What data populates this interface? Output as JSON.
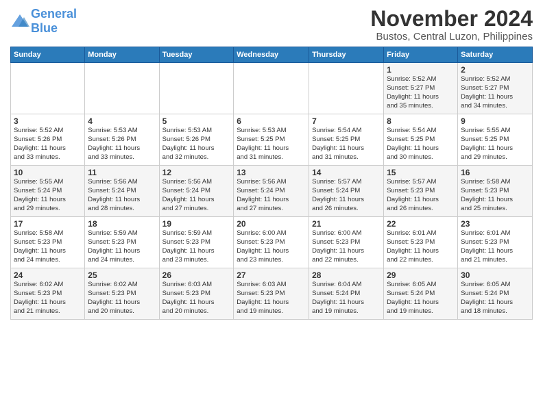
{
  "logo": {
    "text_general": "General",
    "text_blue": "Blue"
  },
  "header": {
    "month_year": "November 2024",
    "location": "Bustos, Central Luzon, Philippines"
  },
  "weekdays": [
    "Sunday",
    "Monday",
    "Tuesday",
    "Wednesday",
    "Thursday",
    "Friday",
    "Saturday"
  ],
  "weeks": [
    [
      {
        "day": "",
        "info": ""
      },
      {
        "day": "",
        "info": ""
      },
      {
        "day": "",
        "info": ""
      },
      {
        "day": "",
        "info": ""
      },
      {
        "day": "",
        "info": ""
      },
      {
        "day": "1",
        "info": "Sunrise: 5:52 AM\nSunset: 5:27 PM\nDaylight: 11 hours\nand 35 minutes."
      },
      {
        "day": "2",
        "info": "Sunrise: 5:52 AM\nSunset: 5:27 PM\nDaylight: 11 hours\nand 34 minutes."
      }
    ],
    [
      {
        "day": "3",
        "info": "Sunrise: 5:52 AM\nSunset: 5:26 PM\nDaylight: 11 hours\nand 33 minutes."
      },
      {
        "day": "4",
        "info": "Sunrise: 5:53 AM\nSunset: 5:26 PM\nDaylight: 11 hours\nand 33 minutes."
      },
      {
        "day": "5",
        "info": "Sunrise: 5:53 AM\nSunset: 5:26 PM\nDaylight: 11 hours\nand 32 minutes."
      },
      {
        "day": "6",
        "info": "Sunrise: 5:53 AM\nSunset: 5:25 PM\nDaylight: 11 hours\nand 31 minutes."
      },
      {
        "day": "7",
        "info": "Sunrise: 5:54 AM\nSunset: 5:25 PM\nDaylight: 11 hours\nand 31 minutes."
      },
      {
        "day": "8",
        "info": "Sunrise: 5:54 AM\nSunset: 5:25 PM\nDaylight: 11 hours\nand 30 minutes."
      },
      {
        "day": "9",
        "info": "Sunrise: 5:55 AM\nSunset: 5:25 PM\nDaylight: 11 hours\nand 29 minutes."
      }
    ],
    [
      {
        "day": "10",
        "info": "Sunrise: 5:55 AM\nSunset: 5:24 PM\nDaylight: 11 hours\nand 29 minutes."
      },
      {
        "day": "11",
        "info": "Sunrise: 5:56 AM\nSunset: 5:24 PM\nDaylight: 11 hours\nand 28 minutes."
      },
      {
        "day": "12",
        "info": "Sunrise: 5:56 AM\nSunset: 5:24 PM\nDaylight: 11 hours\nand 27 minutes."
      },
      {
        "day": "13",
        "info": "Sunrise: 5:56 AM\nSunset: 5:24 PM\nDaylight: 11 hours\nand 27 minutes."
      },
      {
        "day": "14",
        "info": "Sunrise: 5:57 AM\nSunset: 5:24 PM\nDaylight: 11 hours\nand 26 minutes."
      },
      {
        "day": "15",
        "info": "Sunrise: 5:57 AM\nSunset: 5:23 PM\nDaylight: 11 hours\nand 26 minutes."
      },
      {
        "day": "16",
        "info": "Sunrise: 5:58 AM\nSunset: 5:23 PM\nDaylight: 11 hours\nand 25 minutes."
      }
    ],
    [
      {
        "day": "17",
        "info": "Sunrise: 5:58 AM\nSunset: 5:23 PM\nDaylight: 11 hours\nand 24 minutes."
      },
      {
        "day": "18",
        "info": "Sunrise: 5:59 AM\nSunset: 5:23 PM\nDaylight: 11 hours\nand 24 minutes."
      },
      {
        "day": "19",
        "info": "Sunrise: 5:59 AM\nSunset: 5:23 PM\nDaylight: 11 hours\nand 23 minutes."
      },
      {
        "day": "20",
        "info": "Sunrise: 6:00 AM\nSunset: 5:23 PM\nDaylight: 11 hours\nand 23 minutes."
      },
      {
        "day": "21",
        "info": "Sunrise: 6:00 AM\nSunset: 5:23 PM\nDaylight: 11 hours\nand 22 minutes."
      },
      {
        "day": "22",
        "info": "Sunrise: 6:01 AM\nSunset: 5:23 PM\nDaylight: 11 hours\nand 22 minutes."
      },
      {
        "day": "23",
        "info": "Sunrise: 6:01 AM\nSunset: 5:23 PM\nDaylight: 11 hours\nand 21 minutes."
      }
    ],
    [
      {
        "day": "24",
        "info": "Sunrise: 6:02 AM\nSunset: 5:23 PM\nDaylight: 11 hours\nand 21 minutes."
      },
      {
        "day": "25",
        "info": "Sunrise: 6:02 AM\nSunset: 5:23 PM\nDaylight: 11 hours\nand 20 minutes."
      },
      {
        "day": "26",
        "info": "Sunrise: 6:03 AM\nSunset: 5:23 PM\nDaylight: 11 hours\nand 20 minutes."
      },
      {
        "day": "27",
        "info": "Sunrise: 6:03 AM\nSunset: 5:23 PM\nDaylight: 11 hours\nand 19 minutes."
      },
      {
        "day": "28",
        "info": "Sunrise: 6:04 AM\nSunset: 5:24 PM\nDaylight: 11 hours\nand 19 minutes."
      },
      {
        "day": "29",
        "info": "Sunrise: 6:05 AM\nSunset: 5:24 PM\nDaylight: 11 hours\nand 19 minutes."
      },
      {
        "day": "30",
        "info": "Sunrise: 6:05 AM\nSunset: 5:24 PM\nDaylight: 11 hours\nand 18 minutes."
      }
    ]
  ]
}
